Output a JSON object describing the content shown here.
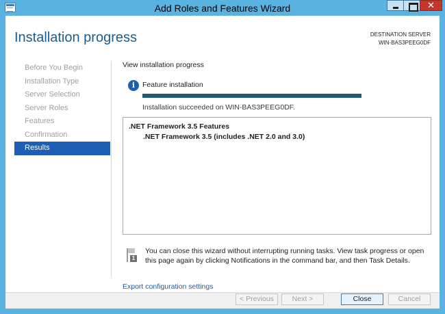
{
  "window": {
    "title": "Add Roles and Features Wizard",
    "close_glyph": "✕"
  },
  "header": {
    "title": "Installation progress",
    "destination_label": "DESTINATION SERVER",
    "destination_server": "WIN-BAS3PEEG0DF"
  },
  "nav": {
    "items": [
      {
        "label": "Before You Begin",
        "active": false
      },
      {
        "label": "Installation Type",
        "active": false
      },
      {
        "label": "Server Selection",
        "active": false
      },
      {
        "label": "Server Roles",
        "active": false
      },
      {
        "label": "Features",
        "active": false
      },
      {
        "label": "Confirmation",
        "active": false
      },
      {
        "label": "Results",
        "active": true
      }
    ]
  },
  "main": {
    "section_heading": "View installation progress",
    "info_icon": "i",
    "feature_label": "Feature installation",
    "progress_value": 1.0,
    "status_text": "Installation succeeded on WIN-BAS3PEEG0DF.",
    "results": {
      "parent": ".NET Framework 3.5 Features",
      "child": ".NET Framework 3.5 (includes .NET 2.0 and 3.0)"
    },
    "notice_badge": "1",
    "notice": "You can close this wizard without interrupting running tasks. View task progress or open this page again by clicking Notifications in the command bar, and then Task Details.",
    "export_link": "Export configuration settings"
  },
  "buttons": {
    "previous": "< Previous",
    "next": "Next >",
    "close": "Close",
    "cancel": "Cancel"
  },
  "colors": {
    "titlebar": "#5ab2e0",
    "accent": "#1e5eb4",
    "title_text": "#1d5c8f",
    "progress": "#1e5a73",
    "link": "#1f5aa6"
  }
}
